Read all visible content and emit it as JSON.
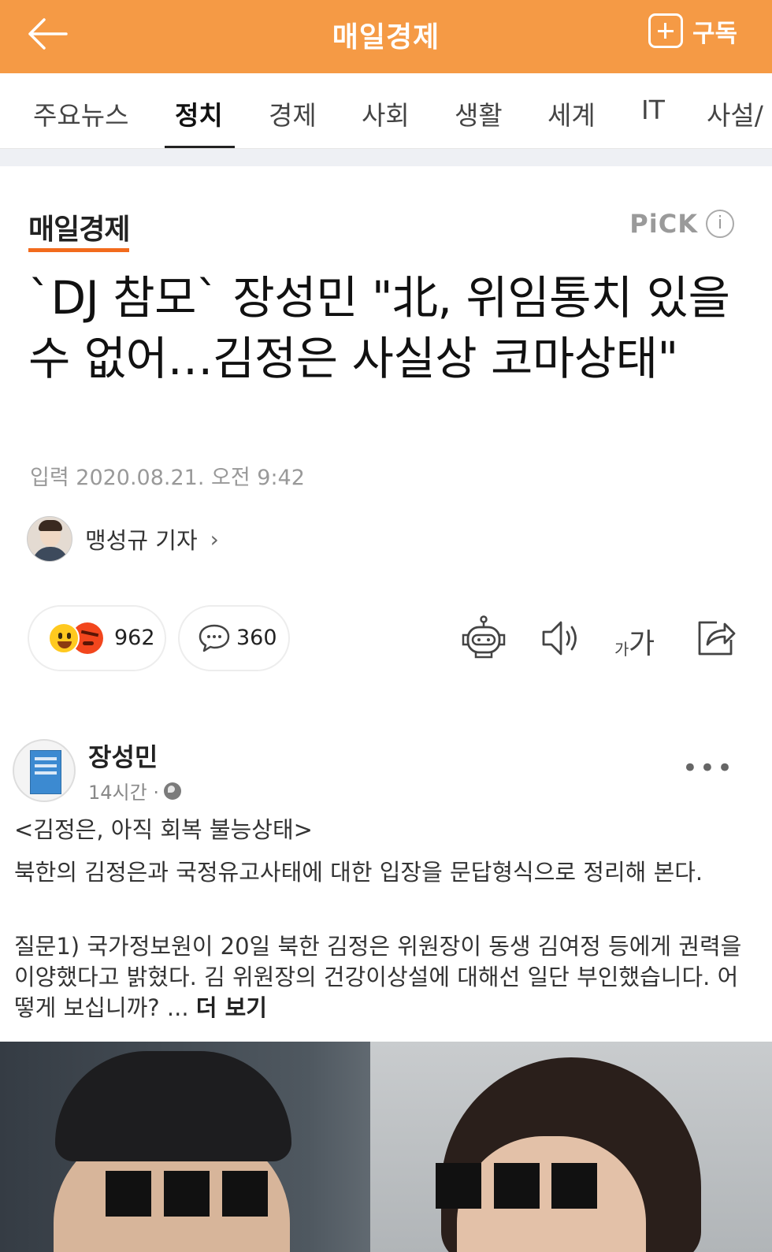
{
  "topbar": {
    "title": "매일경제",
    "subscribe_label": "구독",
    "bg_color": "#f59a45"
  },
  "tabs": [
    {
      "label": "주요뉴스",
      "active": false
    },
    {
      "label": "정치",
      "active": true
    },
    {
      "label": "경제",
      "active": false
    },
    {
      "label": "사회",
      "active": false
    },
    {
      "label": "생활",
      "active": false
    },
    {
      "label": "세계",
      "active": false
    },
    {
      "label": "IT",
      "active": false
    },
    {
      "label": "사설/",
      "active": false
    }
  ],
  "article": {
    "press_logo": "매일경제",
    "pick_label": "PiCK",
    "pick_info": "i",
    "headline": "`DJ 참모` 장성민 \"北, 위임통치 있을 수 없어…김정은 사실상 코마상태\"",
    "dateline": "입력 2020.08.21. 오전 9:42",
    "reporter": "맹성규 기자",
    "reporter_chevron": "›"
  },
  "actions": {
    "reaction_count": "962",
    "comment_count": "360",
    "font_small": "가",
    "font_big": "가"
  },
  "fb_post": {
    "author": "장성민",
    "time": "14시간 ·",
    "more": "•••",
    "subject": "<김정은, 아직 회복 불능상태>",
    "intro": "북한의 김정은과 국정유고사태에 대한 입장을 문답형식으로 정리해 본다.",
    "question": "질문1) 국가정보원이 20일 북한 김정은 위원장이 동생 김여정 등에게 권력을 이양했다고 밝혔다. 김 위원장의 건강이상설에 대해선 일단 부인했습니다. 어떻게 보십니까? ... ",
    "more_link": "더 보기"
  },
  "icons": [
    "back-arrow-icon",
    "plus-box-icon",
    "info-icon",
    "happy-emoji-icon",
    "angry-emoji-icon",
    "comment-bubble-icon",
    "robot-icon",
    "speaker-icon",
    "font-size-icon",
    "share-icon",
    "globe-icon",
    "more-dots-icon",
    "chevron-right-icon"
  ]
}
